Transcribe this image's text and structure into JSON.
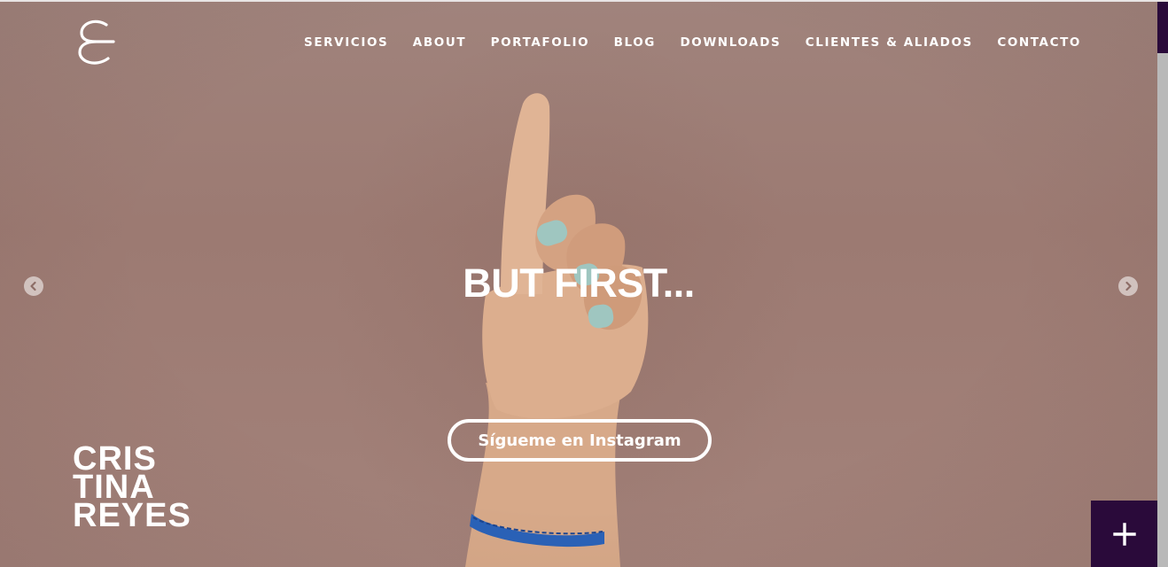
{
  "brand": {
    "logo_icon": "c-monogram-icon",
    "name_lines": [
      "CRIS",
      "TINA",
      "REYES"
    ]
  },
  "nav": {
    "items": [
      {
        "label": "SERVICIOS"
      },
      {
        "label": "ABOUT"
      },
      {
        "label": "PORTAFOLIO"
      },
      {
        "label": "BLOG"
      },
      {
        "label": "DOWNLOADS"
      },
      {
        "label": "CLIENTES & ALIADOS"
      },
      {
        "label": "CONTACTO"
      }
    ]
  },
  "hero": {
    "headline": "BUT FIRST...",
    "cta_label": "Sígueme en Instagram",
    "prev_icon": "chevron-left-icon",
    "next_icon": "chevron-right-icon"
  },
  "fab": {
    "icon": "plus-icon"
  },
  "colors": {
    "accent": "#2a0a3a",
    "hero_bg": "#a0837c",
    "text": "#ffffff"
  }
}
